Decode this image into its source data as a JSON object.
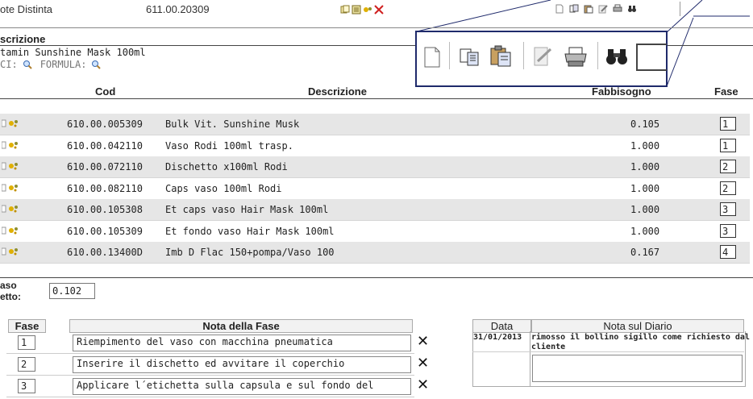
{
  "header": {
    "title": "ote Distinta",
    "code": "611.00.20309"
  },
  "section": {
    "description_heading": "scrizione",
    "product_name": "tamin Sunshine Mask 100ml",
    "ci_label": "CI:",
    "formula_label": "FORMULA:"
  },
  "table": {
    "headers": {
      "cod": "Cod",
      "descrizione": "Descrizione",
      "fabbisogno": "Fabbisogno",
      "fase": "Fase"
    },
    "rows": [
      {
        "cod": "610.00.005309",
        "descr": "Bulk Vit. Sunshine Musk",
        "fabb": "0.105",
        "fase": "1",
        "shade": true
      },
      {
        "cod": "610.00.042110",
        "descr": "Vaso Rodi 100ml trasp.",
        "fabb": "1.000",
        "fase": "1",
        "shade": false
      },
      {
        "cod": "610.00.072110",
        "descr": "Dischetto x100ml Rodi",
        "fabb": "1.000",
        "fase": "2",
        "shade": true
      },
      {
        "cod": "610.00.082110",
        "descr": "Caps vaso 100ml Rodi",
        "fabb": "1.000",
        "fase": "2",
        "shade": false
      },
      {
        "cod": "610.00.105308",
        "descr": "Et caps vaso Hair Mask 100ml",
        "fabb": "1.000",
        "fase": "3",
        "shade": true
      },
      {
        "cod": "610.00.105309",
        "descr": "Et fondo vaso Hair Mask 100ml",
        "fabb": "1.000",
        "fase": "3",
        "shade": false
      },
      {
        "cod": "610.00.13400D",
        "descr": "Imb D Flac 150+pompa/Vaso 100",
        "fabb": "0.167",
        "fase": "4",
        "shade": true
      }
    ]
  },
  "peso": {
    "label_line1": "aso",
    "label_line2": "etto:",
    "value": "0.102"
  },
  "phases": {
    "headers": {
      "fase": "Fase",
      "nota": "Nota della Fase"
    },
    "items": [
      {
        "fase": "1",
        "nota": "Riempimento del vaso con macchina pneumatica"
      },
      {
        "fase": "2",
        "nota": "Inserire il dischetto ed avvitare il coperchio"
      },
      {
        "fase": "3",
        "nota": "Applicare l´etichetta sulla capsula e sul fondo del"
      }
    ]
  },
  "diary": {
    "headers": {
      "data": "Data",
      "nota": "Nota sul Diario"
    },
    "entry": {
      "date": "31/01/2013",
      "text_line1": "rimosso il bollino sigillo come richiesto dal",
      "text_line2": "cliente"
    }
  },
  "colors": {
    "zoom_border": "#1f2a6b",
    "row_shade": "#e6e6e6"
  }
}
